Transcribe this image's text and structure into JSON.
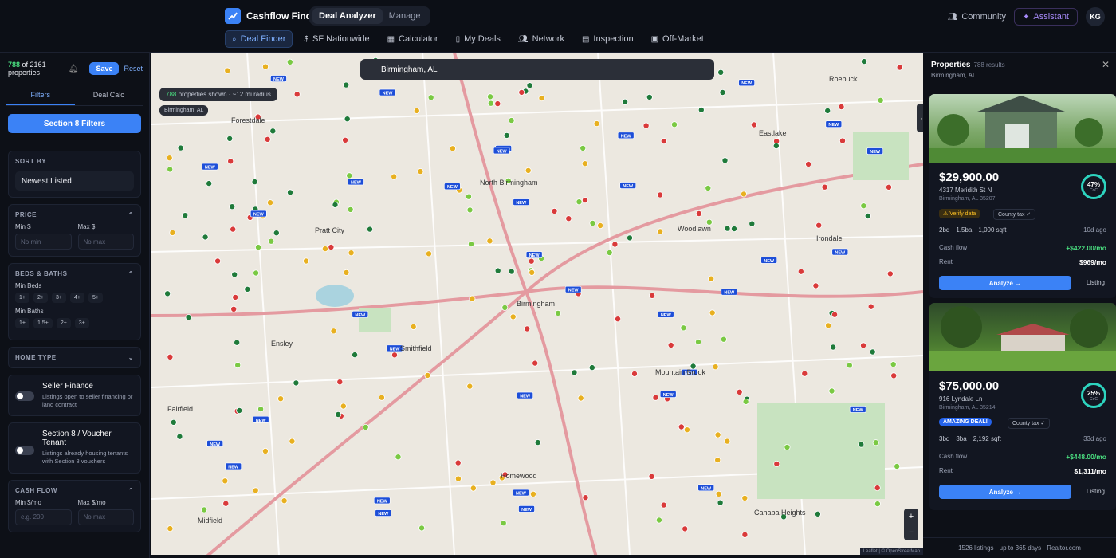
{
  "app": {
    "name": "Cashflow Finder",
    "modes": [
      "Deal Analyzer",
      "Manage"
    ]
  },
  "topright": {
    "community": "Community",
    "assistant": "Assistant",
    "avatar": "KG"
  },
  "nav": [
    "Deal Finder",
    "SF Nationwide",
    "Calculator",
    "My Deals",
    "Network",
    "Inspection",
    "Off-Market"
  ],
  "sidebar": {
    "count": "788",
    "count_of": "of 2161 properties",
    "save": "Save",
    "reset": "Reset",
    "tabs": [
      "Filters",
      "Deal Calc"
    ],
    "s8_button": "Section 8 Filters",
    "sort_label": "SORT BY",
    "sort_value": "Newest Listed",
    "price_label": "PRICE",
    "min_label": "Min $",
    "max_label": "Max $",
    "min_ph": "No min",
    "max_ph": "No max",
    "beds_label": "BEDS & BATHS",
    "min_beds": "Min Beds",
    "min_baths": "Min Baths",
    "beds": [
      "1+",
      "2+",
      "3+",
      "4+",
      "5+"
    ],
    "baths": [
      "1+",
      "1.5+",
      "2+",
      "3+"
    ],
    "home_type": "HOME TYPE",
    "seller_title": "Seller Finance",
    "seller_desc": "Listings open to seller financing or land contract",
    "s8_title": "Section 8 / Voucher Tenant",
    "s8_desc": "Listings already housing tenants with Section 8 vouchers",
    "cash_label": "CASH FLOW",
    "cash_min": "Min $/mo",
    "cash_max": "Max $/mo",
    "cash_min_ph": "e.g. 200",
    "cash_max_ph": "No max"
  },
  "map": {
    "search": "Birmingham, AL",
    "shown_count": "788",
    "shown_text": "properties shown",
    "radius": "~12 mi radius",
    "city_label": "Birmingham, AL",
    "new_badge": "NEW",
    "labels": [
      "Forestdale",
      "North Birmingham",
      "Pratt City",
      "Birmingham",
      "Ensley",
      "Smithfield",
      "Fairfield",
      "Midfield",
      "Homewood",
      "Mountain Brook",
      "Woodlawn",
      "Irondale",
      "Roebuck",
      "Eastlake",
      "Cahaba Heights"
    ],
    "zoom_in": "+",
    "zoom_out": "−",
    "attribution": "Leaflet | © OpenStreetMap"
  },
  "results": {
    "title": "Properties",
    "count": "788 results",
    "location": "Birmingham, AL",
    "footer": "1526 listings · up to 365 days · Realtor.com",
    "analyze": "Analyze →",
    "listing": "Listing",
    "cashflow_label": "Cash flow",
    "rent_label": "Rent",
    "items": [
      {
        "price": "$29,900.00",
        "address": "4317 Meridith St N",
        "city": "Birmingham, AL 35207",
        "coc": "47%",
        "badge": "Verify data",
        "county": "County tax ✓",
        "beds": "2bd",
        "baths": "1.5ba",
        "sqft": "1,000 sqft",
        "ago": "10d ago",
        "cashflow": "+$422.00/mo",
        "rent": "$969/mo"
      },
      {
        "price": "$75,000.00",
        "address": "916 Lyndale Ln",
        "city": "Birmingham, AL 35214",
        "coc": "25%",
        "badge": "AMAZING DEAL!",
        "county": "County tax ✓",
        "beds": "3bd",
        "baths": "3ba",
        "sqft": "2,192 sqft",
        "ago": "33d ago",
        "cashflow": "+$448.00/mo",
        "rent": "$1,311/mo"
      }
    ]
  }
}
